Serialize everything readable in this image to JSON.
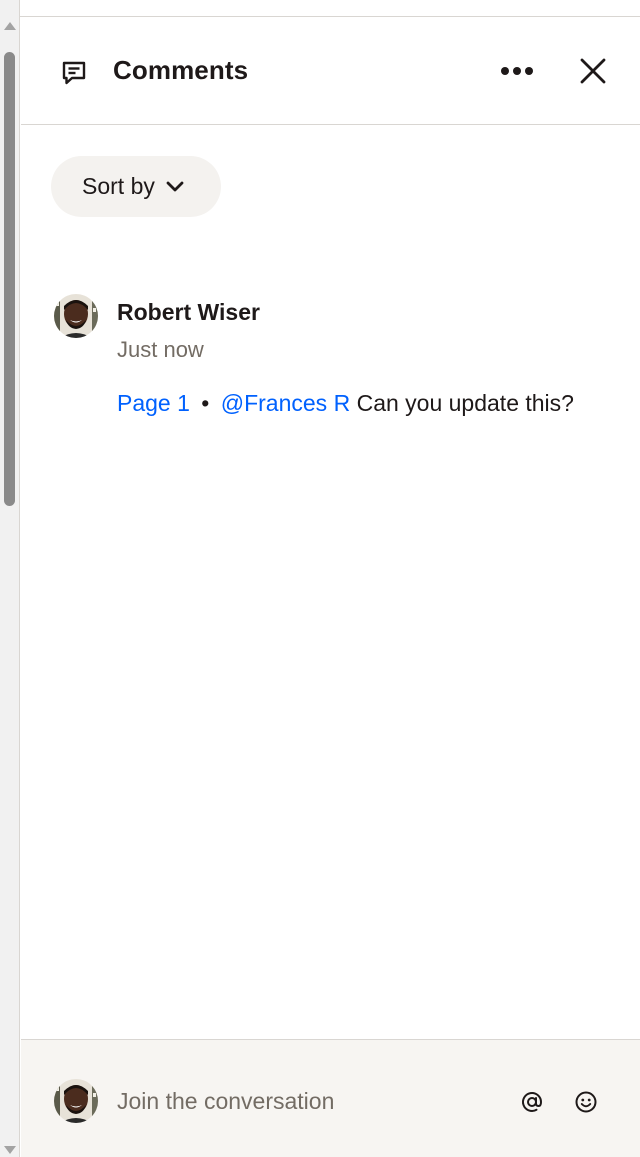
{
  "header": {
    "title": "Comments",
    "icon": "comment-icon",
    "more_icon": "more-horizontal-icon",
    "close_icon": "close-icon"
  },
  "sort": {
    "label": "Sort by",
    "icon": "chevron-down-icon"
  },
  "comments": [
    {
      "author": "Robert Wiser",
      "time": "Just now",
      "page_link": "Page 1",
      "separator": "•",
      "mention": "@Frances R",
      "text": "Can you update this?"
    }
  ],
  "composer": {
    "placeholder": "Join the conversation",
    "mention_icon": "at-sign-icon",
    "emoji_icon": "smiley-icon"
  },
  "colors": {
    "link": "#0061fe",
    "text": "#1e1919",
    "muted": "#736c64",
    "sort_bg": "#f4f2ef",
    "footer_bg": "#f7f5f2"
  }
}
